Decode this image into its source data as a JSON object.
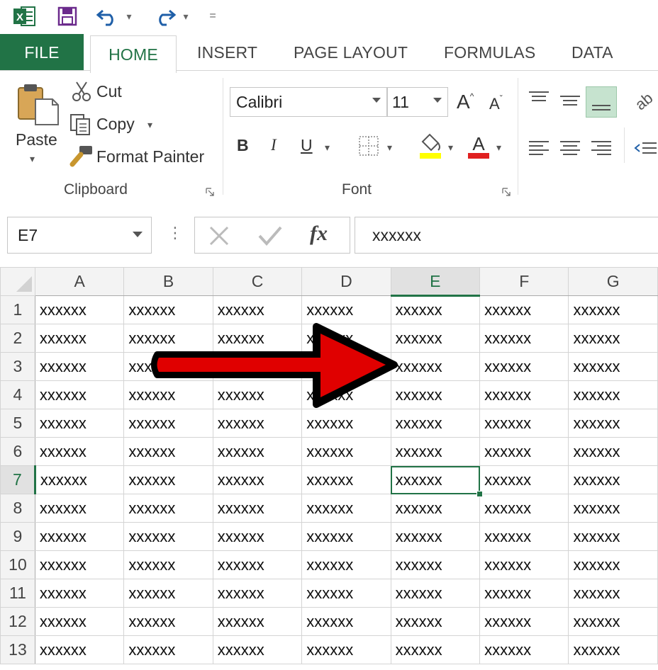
{
  "qat": {
    "undo_arrow": "▾",
    "redo_arrow": "▾",
    "customize": "="
  },
  "tabs": [
    "FILE",
    "HOME",
    "INSERT",
    "PAGE LAYOUT",
    "FORMULAS",
    "DATA"
  ],
  "clipboard": {
    "paste": "Paste",
    "paste_arrow": "▾",
    "cut": "Cut",
    "copy": "Copy",
    "copy_arrow": "▾",
    "format_painter": "Format Painter",
    "group_label": "Clipboard"
  },
  "font": {
    "family": "Calibri",
    "size": "11",
    "grow": "A",
    "shrink": "A",
    "bold": "B",
    "italic": "I",
    "underline": "U",
    "group_label": "Font",
    "fill_color": "#ffff00",
    "font_color": "#e02020"
  },
  "formula_bar": {
    "name_box": "E7",
    "content": "xxxxxx",
    "fx": "fx",
    "more": "⋮"
  },
  "sheet": {
    "columns": [
      "A",
      "B",
      "C",
      "D",
      "E",
      "F",
      "G"
    ],
    "rows": [
      "1",
      "2",
      "3",
      "4",
      "5",
      "6",
      "7",
      "8",
      "9",
      "10",
      "11",
      "12",
      "13"
    ],
    "cell_value": "xxxxxx",
    "active_cell": "E7",
    "selected_column": "E",
    "selected_row": "7"
  },
  "colors": {
    "accent": "#217346",
    "arrow": "#e00000"
  }
}
